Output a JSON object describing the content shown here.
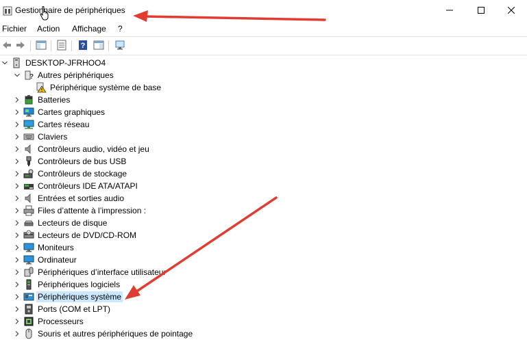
{
  "window": {
    "title": "Gestionnaire de périphériques",
    "controls": [
      "minimize-icon",
      "maximize-icon",
      "close-icon"
    ]
  },
  "menu": [
    {
      "label": "Fichier"
    },
    {
      "label": "Action"
    },
    {
      "label": "Affichage"
    },
    {
      "label": "?"
    }
  ],
  "toolbar": {
    "buttons": [
      "back-arrow-icon",
      "forward-arrow-icon",
      "show-hide-console-tree-icon",
      "properties-icon",
      "help-icon",
      "action-pane-icon",
      "scan-hardware-icon"
    ]
  },
  "tree": {
    "root": {
      "label": "DESKTOP-JFRHOO4",
      "expanded": true
    },
    "items": [
      {
        "label": "Autres périphériques",
        "expanded": true,
        "icon": "unknown-device-icon",
        "children": [
          {
            "label": "Périphérique système de base",
            "icon": "warning-device-icon"
          }
        ]
      },
      {
        "label": "Batteries",
        "icon": "battery-icon"
      },
      {
        "label": "Cartes graphiques",
        "icon": "display-adapter-icon"
      },
      {
        "label": "Cartes réseau",
        "icon": "network-adapter-icon"
      },
      {
        "label": "Claviers",
        "icon": "keyboard-icon"
      },
      {
        "label": "Contrôleurs audio, vidéo et jeu",
        "icon": "speaker-icon"
      },
      {
        "label": "Contrôleurs de bus USB",
        "icon": "usb-icon"
      },
      {
        "label": "Contrôleurs de stockage",
        "icon": "storage-controller-icon"
      },
      {
        "label": "Contrôleurs IDE ATA/ATAPI",
        "icon": "ide-controller-icon"
      },
      {
        "label": "Entrées et sorties audio",
        "icon": "speaker-icon"
      },
      {
        "label": "Files d’attente à l’impression :",
        "icon": "print-queue-icon"
      },
      {
        "label": "Lecteurs de disque",
        "icon": "disk-drive-icon"
      },
      {
        "label": "Lecteurs de DVD/CD-ROM",
        "icon": "dvd-drive-icon"
      },
      {
        "label": "Moniteurs",
        "icon": "monitor-icon"
      },
      {
        "label": "Ordinateur",
        "icon": "computer-icon"
      },
      {
        "label": "Périphériques d’interface utilisateur",
        "icon": "hid-icon"
      },
      {
        "label": "Périphériques logiciels",
        "icon": "software-device-icon"
      },
      {
        "label": "Périphériques système",
        "icon": "system-device-icon",
        "selected": true
      },
      {
        "label": "Ports (COM et LPT)",
        "icon": "port-icon"
      },
      {
        "label": "Processeurs",
        "icon": "processor-icon"
      },
      {
        "label": "Souris et autres périphériques de pointage",
        "icon": "mouse-icon"
      }
    ]
  },
  "colors": {
    "selection": "#cce8ff",
    "annotation_arrow": "#e03c31"
  }
}
